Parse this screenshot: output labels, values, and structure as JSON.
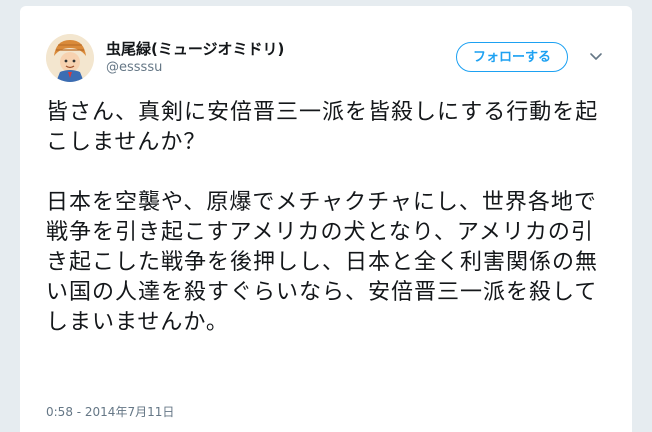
{
  "tweet": {
    "display_name": "虫尾緑(ミュージオミドリ)",
    "handle": "@essssu",
    "follow_label": "フォローする",
    "paragraphs": [
      "皆さん、真剣に安倍晋三一派を皆殺しにする行動を起こしませんか？",
      "日本を空襲や、原爆でメチャクチャにし、世界各地で戦争を引き起こすアメリカの犬となり、アメリカの引き起こした戦争を後押しし、日本と全く利害関係の無い国の人達を殺すぐらいなら、安倍晋三一派を殺してしまいませんか。"
    ],
    "timestamp": "0:58 - 2014年7月11日"
  },
  "colors": {
    "accent": "#1da1f2",
    "text": "#14171a",
    "muted": "#657786",
    "background": "#e6ecf0"
  },
  "icons": {
    "menu": "chevron-down-icon",
    "avatar": "avatar"
  }
}
